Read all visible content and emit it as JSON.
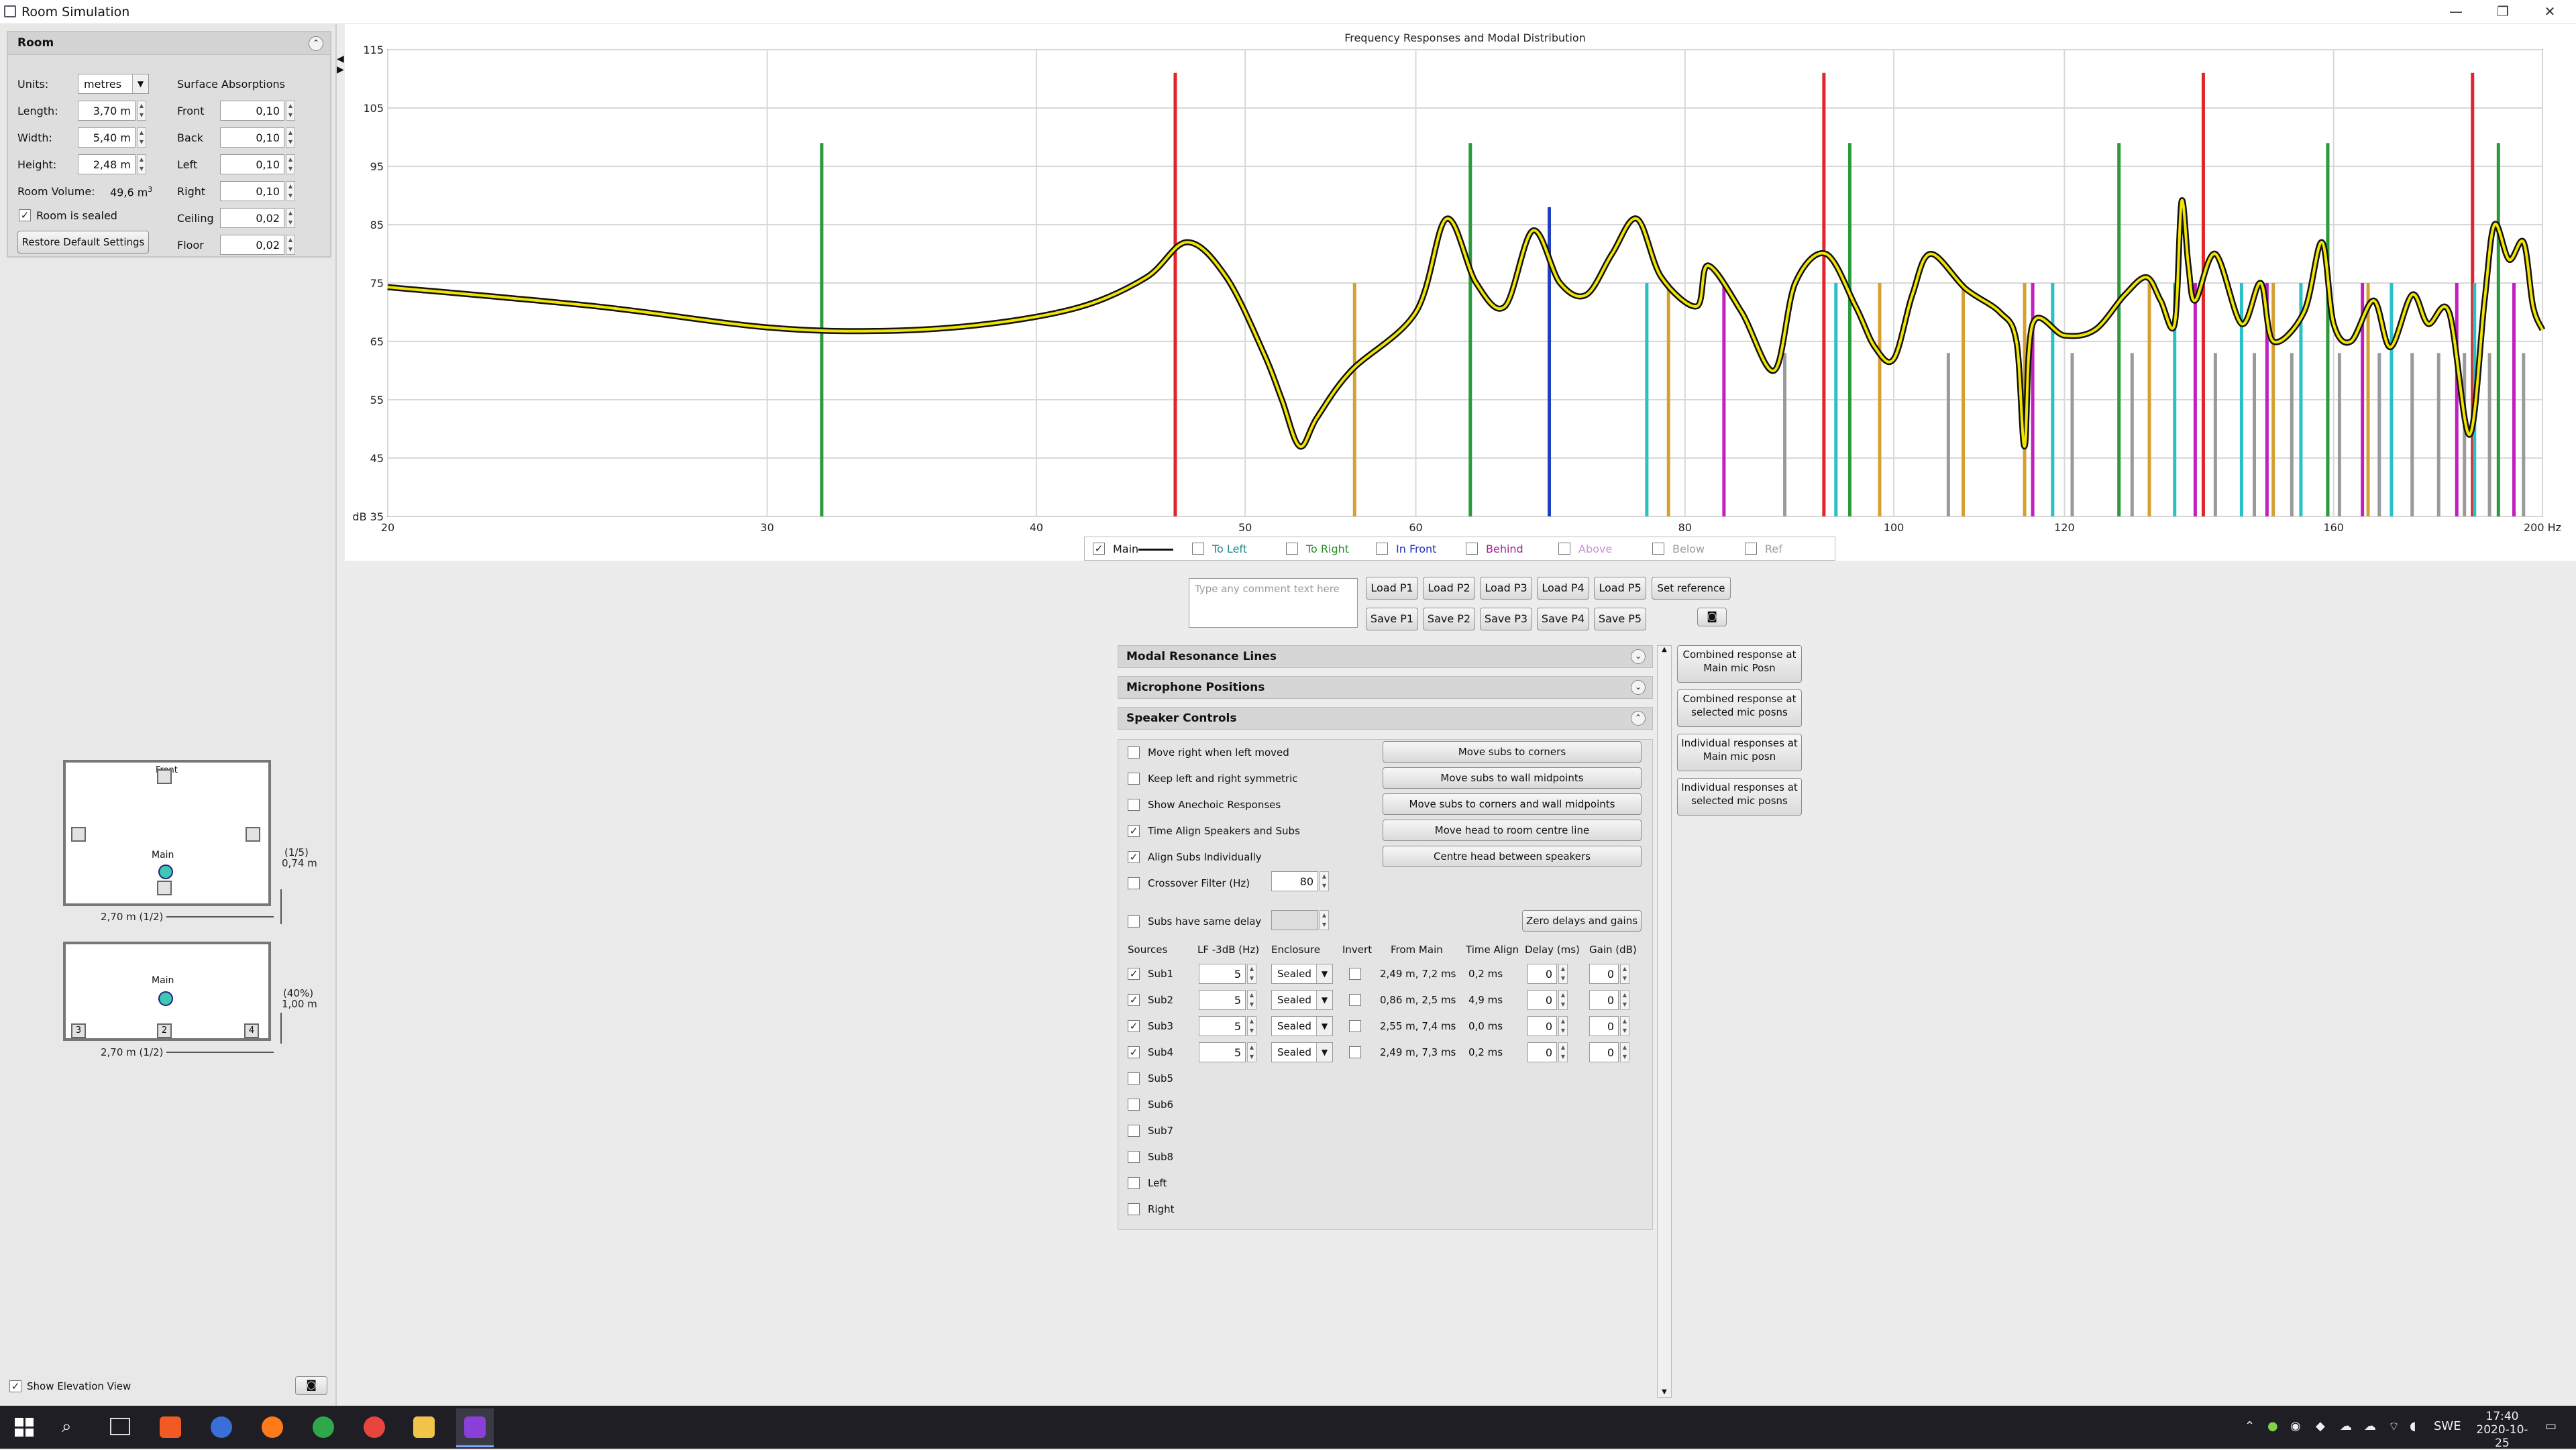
{
  "window": {
    "title": "Room Simulation",
    "minimize": "—",
    "restore": "❐",
    "close": "✕"
  },
  "room": {
    "header": "Room",
    "units_label": "Units:",
    "units_value": "metres",
    "length_label": "Length:",
    "length_value": "3,70 m",
    "width_label": "Width:",
    "width_value": "5,40 m",
    "height_label": "Height:",
    "height_value": "2,48 m",
    "volume_label": "Room Volume:",
    "volume_value": "49,6 m",
    "volume_unit_sup": "3",
    "sealed_label": "Room is sealed",
    "restore_button": "Restore Default Settings",
    "absorptions_header": "Surface Absorptions",
    "absorptions": [
      {
        "label": "Front",
        "value": "0,10"
      },
      {
        "label": "Back",
        "value": "0,10"
      },
      {
        "label": "Left",
        "value": "0,10"
      },
      {
        "label": "Right",
        "value": "0,10"
      },
      {
        "label": "Ceiling",
        "value": "0,02"
      },
      {
        "label": "Floor",
        "value": "0,02"
      }
    ]
  },
  "plan_view": {
    "front_label": "Front",
    "main_label": "Main",
    "side_dim": "(1/5)",
    "side_dim2": "0,74 m",
    "width_dim": "2,70 m (1/2)"
  },
  "elevation_view": {
    "main_label": "Main",
    "side_dim": "(40%)",
    "side_dim2": "1,00 m",
    "width_dim": "2,70 m (1/2)",
    "sub_labels": [
      "3",
      "2",
      "4"
    ]
  },
  "show_elevation_label": "Show Elevation View",
  "chart_data": {
    "type": "line",
    "title": "Frequency Responses and Modal Distribution",
    "x_scale": "log",
    "xlim": [
      20,
      200
    ],
    "ylim": [
      35,
      115
    ],
    "x_ticks": [
      "20",
      "30",
      "40",
      "50",
      "60",
      "80",
      "100",
      "120",
      "160",
      "200 Hz"
    ],
    "x_tick_values": [
      20,
      30,
      40,
      50,
      60,
      80,
      100,
      120,
      160,
      200
    ],
    "y_ticks": [
      "dB 35",
      "45",
      "55",
      "65",
      "75",
      "85",
      "95",
      "105",
      "115"
    ],
    "y_tick_values": [
      35,
      45,
      55,
      65,
      75,
      85,
      95,
      105,
      115
    ],
    "grid": true,
    "series": [
      {
        "name": "Main",
        "color": "#f0e400",
        "points": [
          [
            20,
            74.3
          ],
          [
            25,
            71
          ],
          [
            30,
            67.4
          ],
          [
            34,
            66.8
          ],
          [
            38,
            68
          ],
          [
            42,
            71
          ],
          [
            45,
            76
          ],
          [
            47,
            82
          ],
          [
            49,
            76
          ],
          [
            51,
            63
          ],
          [
            52,
            55
          ],
          [
            53,
            47
          ],
          [
            54,
            52
          ],
          [
            56,
            60
          ],
          [
            60,
            70
          ],
          [
            62,
            86
          ],
          [
            64,
            75
          ],
          [
            66,
            71
          ],
          [
            68,
            84
          ],
          [
            70,
            75
          ],
          [
            72,
            73
          ],
          [
            74,
            80
          ],
          [
            76,
            86
          ],
          [
            78,
            76
          ],
          [
            81,
            71
          ],
          [
            82,
            78
          ],
          [
            85,
            70
          ],
          [
            88,
            60
          ],
          [
            90,
            75
          ],
          [
            93,
            80
          ],
          [
            96,
            71
          ],
          [
            98,
            64
          ],
          [
            100,
            62
          ],
          [
            102,
            73
          ],
          [
            104,
            80
          ],
          [
            108,
            74
          ],
          [
            112,
            70
          ],
          [
            114,
            65
          ],
          [
            115,
            47
          ],
          [
            116,
            68
          ],
          [
            120,
            66
          ],
          [
            124,
            67
          ],
          [
            128,
            73
          ],
          [
            131,
            76
          ],
          [
            133,
            72
          ],
          [
            135,
            68
          ],
          [
            136,
            89
          ],
          [
            137,
            78
          ],
          [
            138,
            72
          ],
          [
            141,
            80
          ],
          [
            145,
            68
          ],
          [
            148,
            75
          ],
          [
            150,
            65
          ],
          [
            155,
            70
          ],
          [
            158,
            82
          ],
          [
            160,
            68
          ],
          [
            163,
            65
          ],
          [
            167,
            72
          ],
          [
            170,
            64
          ],
          [
            174,
            73
          ],
          [
            177,
            68
          ],
          [
            181,
            70
          ],
          [
            185,
            49
          ],
          [
            188,
            72
          ],
          [
            190,
            85
          ],
          [
            193,
            79
          ],
          [
            196,
            82
          ],
          [
            198,
            71
          ],
          [
            200,
            67
          ]
        ]
      }
    ],
    "modal_lines": {
      "axial_front_back": {
        "color": "#e0262a",
        "freqs": [
          46.4,
          92.8,
          139.2,
          185.6
        ],
        "levels": [
          111,
          111,
          111,
          111
        ]
      },
      "axial_left_right": {
        "color": "#2a9a3a",
        "freqs": [
          31.8,
          63.6,
          95.4,
          127.2,
          159.0,
          190.8
        ],
        "levels": [
          99,
          99,
          99,
          99,
          99,
          99
        ]
      },
      "axial_floor_ceiling": {
        "color": "#2040c0",
        "freqs": [
          69.2
        ],
        "levels": [
          88
        ]
      },
      "tangential_a": {
        "color": "#d4a030",
        "freqs": [
          56.2,
          78.6,
          98.5,
          107.7,
          115.0,
          131.4,
          150.0,
          166.0
        ],
        "levels": [
          75,
          75,
          75,
          75,
          75,
          75,
          75,
          75
        ]
      },
      "tangential_b": {
        "color": "#2ac0c8",
        "freqs": [
          76.8,
          94.0,
          118.5,
          135.0,
          145.0,
          154.5,
          170.2,
          186.0
        ],
        "levels": [
          75,
          75,
          75,
          75,
          75,
          75,
          75,
          75
        ]
      },
      "tangential_c": {
        "color": "#c020c0",
        "freqs": [
          83.4,
          116.0,
          138.0,
          149.0,
          165.0,
          182.5,
          194.0
        ],
        "levels": [
          75,
          75,
          75,
          75,
          75,
          75,
          75
        ]
      },
      "oblique": {
        "color": "#9a9a9a",
        "freqs": [
          89.0,
          106.0,
          121.0,
          129.0,
          141.0,
          147.0,
          153.0,
          161.0,
          168.0,
          174.0,
          179.0,
          184.0,
          189.0,
          196.0
        ],
        "levels": [
          63,
          63,
          63,
          63,
          63,
          63,
          63,
          63,
          63,
          63,
          63,
          63,
          63,
          63
        ]
      }
    }
  },
  "legend": {
    "items": [
      {
        "label": "Main",
        "checked": true,
        "color": "#111111"
      },
      {
        "label": "To Left",
        "checked": false,
        "color": "#1e8a8a"
      },
      {
        "label": "To Right",
        "checked": false,
        "color": "#2a8a2a"
      },
      {
        "label": "In Front",
        "checked": false,
        "color": "#2030b0"
      },
      {
        "label": "Behind",
        "checked": false,
        "color": "#a02090"
      },
      {
        "label": "Above",
        "checked": false,
        "color": "#c890d8"
      },
      {
        "label": "Below",
        "checked": false,
        "color": "#9a9a9a"
      },
      {
        "label": "Ref",
        "checked": false,
        "color": "#9a9a9a"
      }
    ]
  },
  "comment_placeholder": "Type any comment text here",
  "load_buttons": [
    "Load P1",
    "Load P2",
    "Load P3",
    "Load P4",
    "Load P5"
  ],
  "save_buttons": [
    "Save P1",
    "Save P2",
    "Save P3",
    "Save P4",
    "Save P5"
  ],
  "set_reference": "Set reference",
  "sections": {
    "modal": "Modal Resonance Lines",
    "mic": "Microphone Positions",
    "speaker": "Speaker Controls"
  },
  "speaker_controls": {
    "checks": [
      {
        "label": "Move right when left moved",
        "checked": false
      },
      {
        "label": "Keep left and right symmetric",
        "checked": false
      },
      {
        "label": "Show Anechoic Responses",
        "checked": false
      },
      {
        "label": "Time Align Speakers and Subs",
        "checked": true
      },
      {
        "label": "Align Subs Individually",
        "checked": true
      },
      {
        "label": "Crossover Filter (Hz)",
        "checked": false
      }
    ],
    "crossover_value": "80",
    "buttons": [
      "Move subs to corners",
      "Move subs to wall midpoints",
      "Move subs to corners and wall midpoints",
      "Move head to room centre line",
      "Centre head between speakers"
    ],
    "same_delay_label": "Subs have same delay",
    "zero_button": "Zero delays and gains",
    "columns": [
      "Sources",
      "LF -3dB (Hz)",
      "Enclosure",
      "Invert",
      "From Main",
      "Time Align",
      "Delay (ms)",
      "Gain (dB)"
    ],
    "subs": [
      {
        "name": "Sub1",
        "checked": true,
        "lf": "5",
        "enclosure": "Sealed",
        "from_main": "2,49 m, 7,2 ms",
        "time_align": "0,2 ms",
        "delay": "0",
        "gain": "0"
      },
      {
        "name": "Sub2",
        "checked": true,
        "lf": "5",
        "enclosure": "Sealed",
        "from_main": "0,86 m, 2,5 ms",
        "time_align": "4,9 ms",
        "delay": "0",
        "gain": "0"
      },
      {
        "name": "Sub3",
        "checked": true,
        "lf": "5",
        "enclosure": "Sealed",
        "from_main": "2,55 m, 7,4 ms",
        "time_align": "0,0 ms",
        "delay": "0",
        "gain": "0"
      },
      {
        "name": "Sub4",
        "checked": true,
        "lf": "5",
        "enclosure": "Sealed",
        "from_main": "2,49 m, 7,3 ms",
        "time_align": "0,2 ms",
        "delay": "0",
        "gain": "0"
      }
    ],
    "other_sources": [
      "Sub5",
      "Sub6",
      "Sub7",
      "Sub8",
      "Left",
      "Right"
    ]
  },
  "side_buttons": [
    [
      "Combined response at",
      "Main mic Posn"
    ],
    [
      "Combined response at",
      "selected mic posns"
    ],
    [
      "Individual responses at",
      "Main mic posn"
    ],
    [
      "Individual responses at",
      "selected mic posns"
    ]
  ],
  "taskbar": {
    "language": "SWE",
    "time": "17:40",
    "date": "2020-10-25"
  }
}
